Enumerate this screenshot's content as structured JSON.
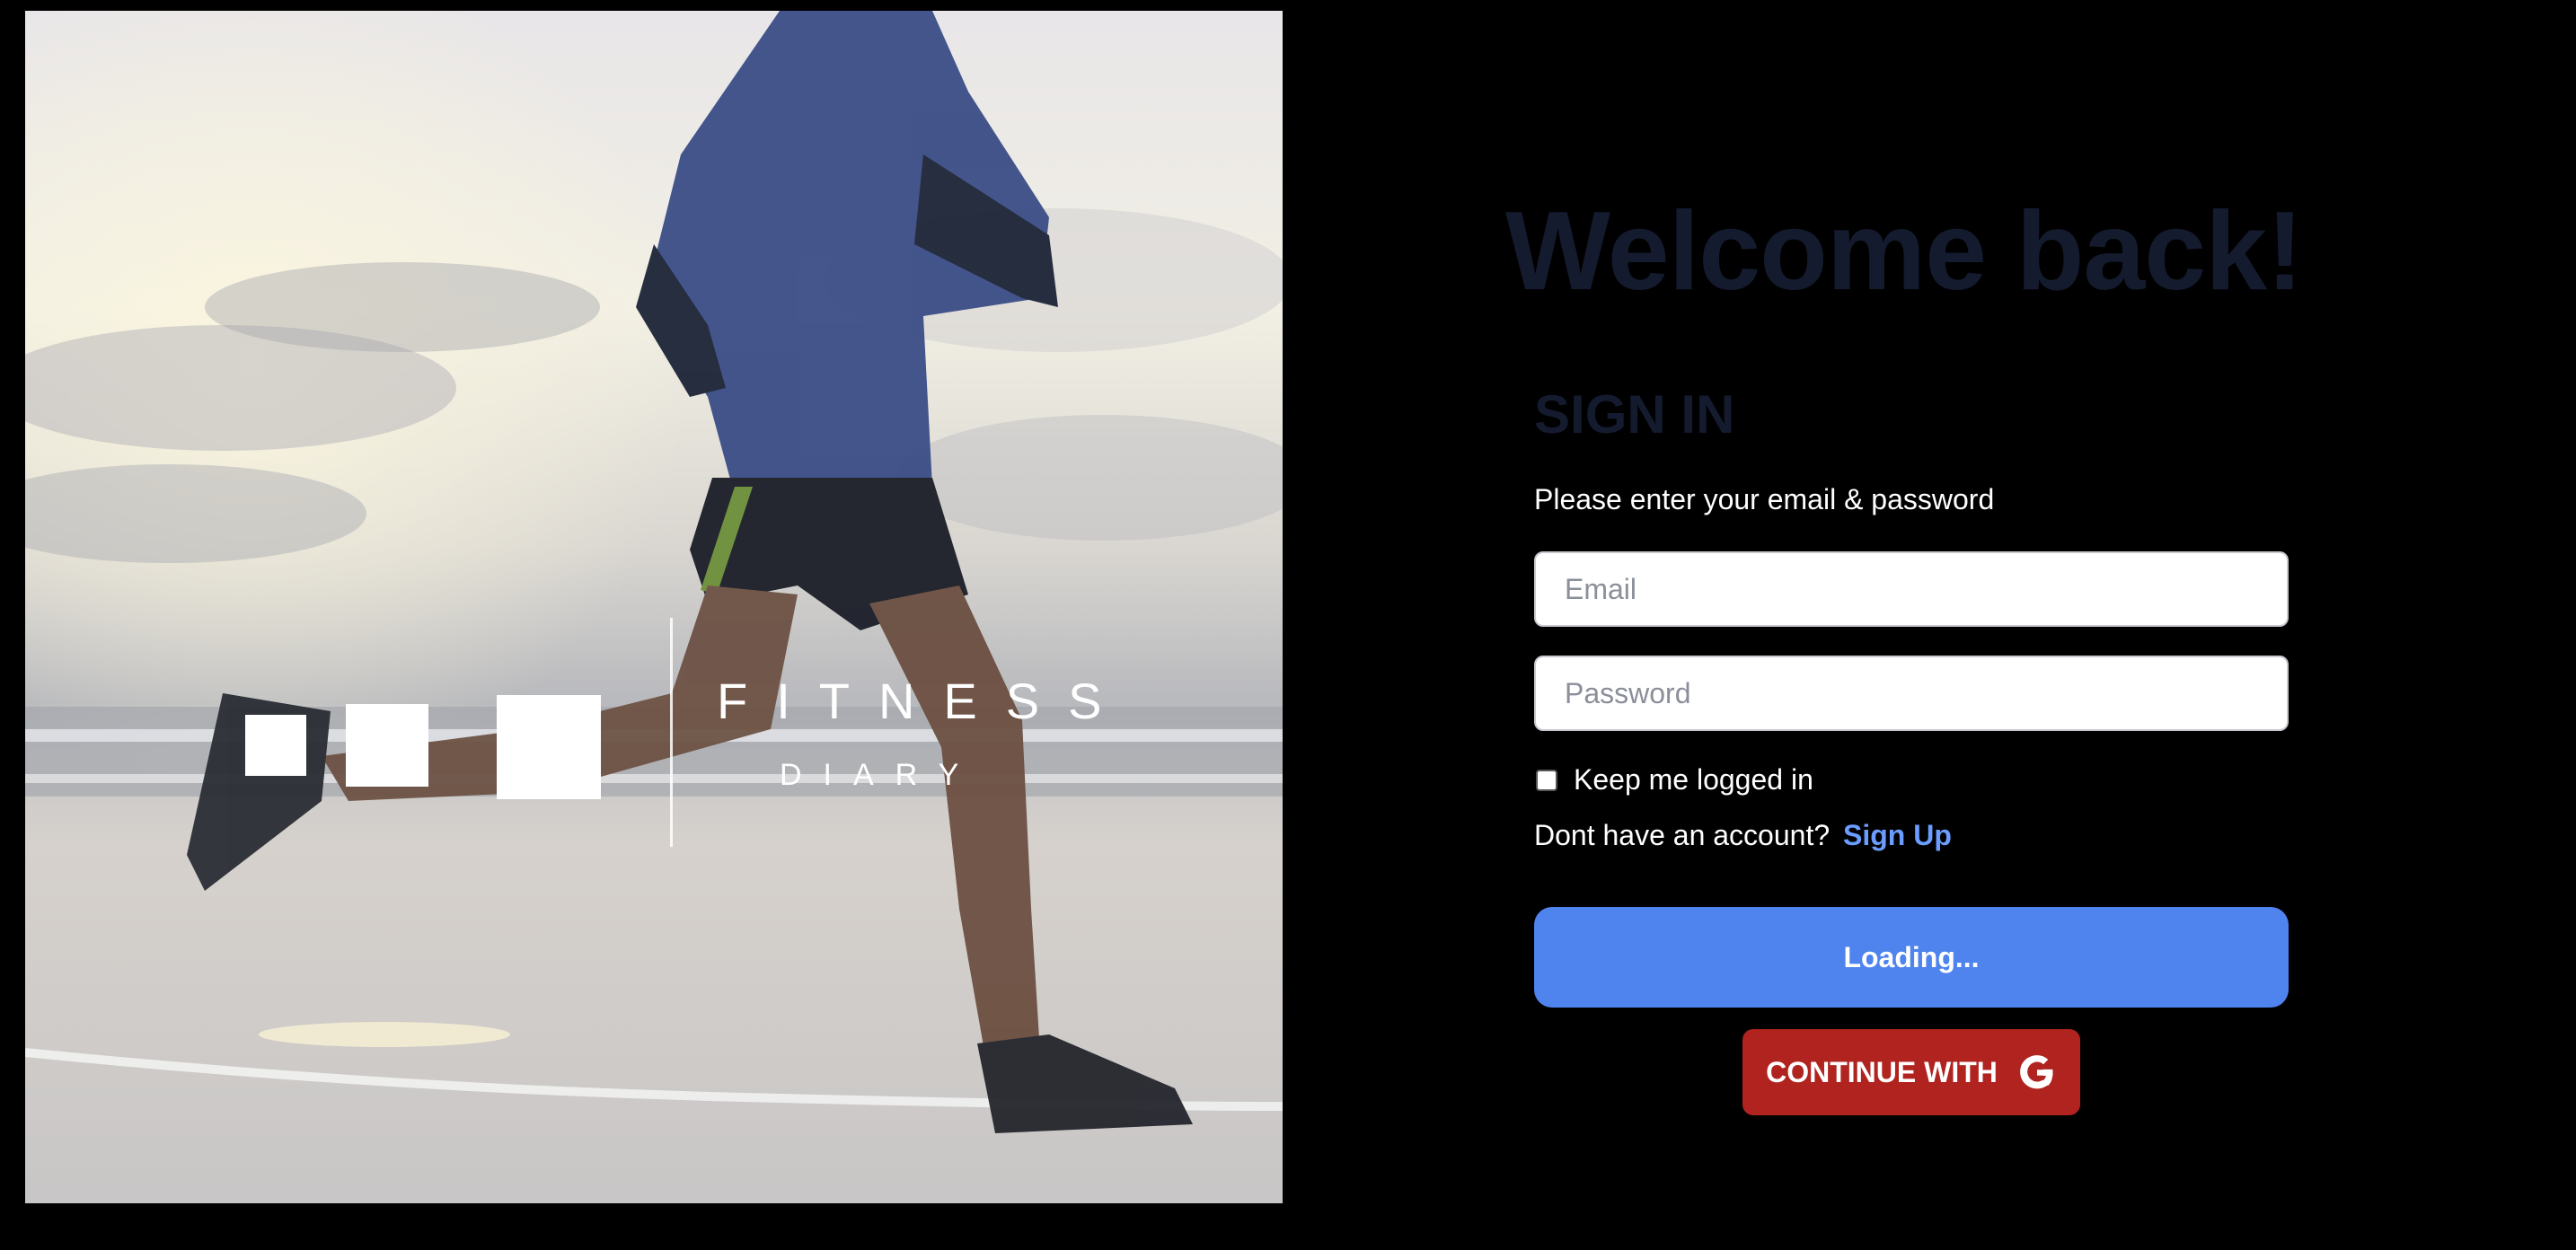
{
  "hero": {
    "logo_word": "FITNESS",
    "logo_sub": "DIARY"
  },
  "form": {
    "welcome": "Welcome back!",
    "title": "SIGN IN",
    "instructions": "Please enter your email & password",
    "email_placeholder": "Email",
    "password_placeholder": "Password",
    "keep_logged_in": "Keep me logged in",
    "keep_logged_in_checked": false,
    "no_account_text": "Dont have an account?",
    "signup_link": "Sign Up",
    "submit_label": "Loading...",
    "google_label": "CONTINUE WITH",
    "google_icon": "google-g-icon"
  },
  "colors": {
    "background": "#000000",
    "heading": "#141b2e",
    "primary_button": "#4f83ee",
    "google_button": "#b0231f",
    "link": "#6b9cff"
  }
}
